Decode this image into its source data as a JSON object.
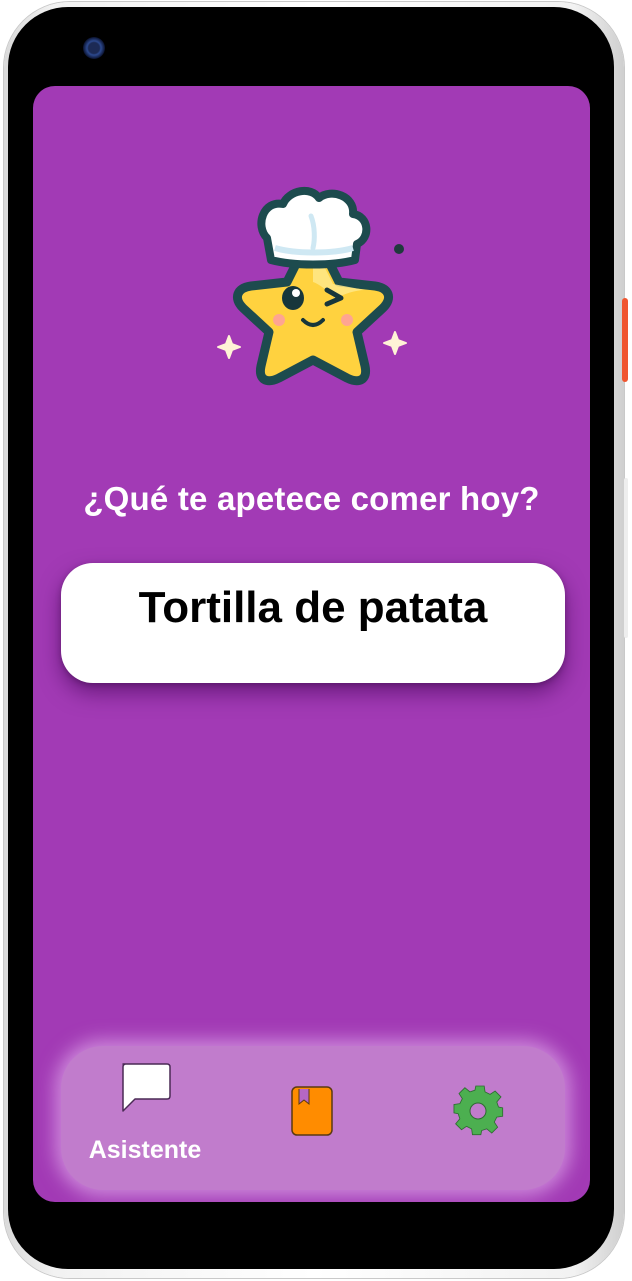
{
  "screen": {
    "background_color": "#a23ab5",
    "mascot": {
      "icon": "chef-star-mascot-icon"
    },
    "question": "¿Qué te apetece comer hoy?",
    "dish_card": {
      "text": "Tortilla de patata"
    }
  },
  "bottom_nav": {
    "background_color": "#c17ccc",
    "items": [
      {
        "icon": "chat-bubble-icon",
        "label": "Asistente",
        "color": "#ffffff"
      },
      {
        "icon": "book-icon",
        "label": "",
        "color": "#ff8c00"
      },
      {
        "icon": "gear-icon",
        "label": "",
        "color": "#4caf50"
      }
    ]
  }
}
